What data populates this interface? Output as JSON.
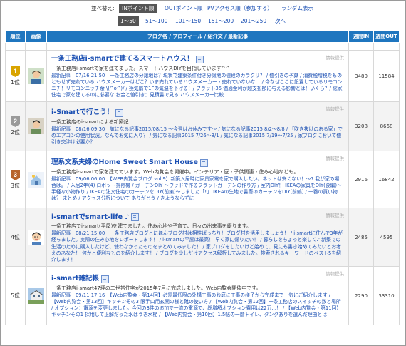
{
  "sort": {
    "label": "並べ替え:",
    "options": [
      "INポイント順",
      "OUTポイント順",
      "PVアクセス順（参加する）",
      "ランダム表示"
    ]
  },
  "pager": {
    "pages": [
      "1〜50",
      "51〜100",
      "101〜150",
      "151〜200",
      "201〜250",
      "次へ"
    ]
  },
  "table": {
    "headers": [
      "順位",
      "画像",
      "ブログ名 / プロフィール / 紹介文 / 最新記事",
      "週間IN",
      "週間OUT"
    ]
  },
  "rows": [
    {
      "rank": "1位",
      "medal_color": "#d9a400",
      "medal_num": "1",
      "title": "一条工務店i-smartで建てるスマートハウス！",
      "info": "情報提供",
      "desc": "一条工務店i-smartで家を建てました。スマートハウスDIYを目指しています^^",
      "posts": "最新記事　07/16 21:50　一条工務店の分譲地は？現状で建築条件付き分譲地の値段のカラクリ？ / 値引きの予算 / 消費税増税をものともせず売れている ハウスメーカーはどこ？いま売れているハウスメーカー・売れていないな… / 今なぜここに設置しているリモコンニチ！リモコンニッチ余 \\(^o^)/ / 換気扇で1Fの気温を下げる！/ フラット35 価適金利が超支払額に与える影響とは！いくら？/ 総家住宅で家を建てるのに必要な お金と値引き：見積書で見る ハウスメーカー比較",
      "in": "3480",
      "out": "11584"
    },
    {
      "rank": "2位",
      "medal_color": "#9a9a9a",
      "medal_num": "2",
      "title": "i-Smartで行こう！",
      "info": "情報提供",
      "desc": "一条工務店のi-smartによる新築記",
      "posts": "最新記事　08/16 09:30　気になる記事2015/08/15 〜今週はお休みです〜 / 気になる記事2015 8/2〜8/8 / 「吹き抜けのある家」でのエアコンの使用状況。なんでお気に入り？ / 気になる記事2015 7/26〜8/1 / 気になる記事2015 7/19〜7/25 / 家ブログにおいて値引き交渉は必要か？",
      "in": "3208",
      "out": "8668"
    },
    {
      "rank": "3位",
      "medal_color": "#b8642b",
      "medal_num": "3",
      "title": "理系文系夫婦のHome Sweet Smart House",
      "info": "情報提供",
      "desc": "一条工務店i-smartで家を建てています。Web内覧会を開催中。インテリア・庭・子供関連・住み心地なども。",
      "posts": "最新記事　09/06 06:00　【WEB内覧会ブログ vol.9】新築入居時に家具家電を家で購入したい。ネットは安くない！〜? 我が家の場合は。 / 入居2年(4) ロボット掃除機 / ガーデンDIY 〜ウッドで作るフラットガーデンの作り方 / 室内DIY！ IKEAの家具をDIY(後編)〜手軽な小物作り / IKEAの注文住宅のカーテンをDIY(前編)〜しました「!」 IKEAの生地で書斎のカーテンをDIY(前編) / 一番の買い物は？ まとめ / アクセス分析について ありがとう / きようならずに",
      "in": "2916",
      "out": "16842"
    },
    {
      "rank": "4位",
      "medal_color": "",
      "medal_num": "",
      "title": "i-smartでsmart-life ♪",
      "info": "情報提供",
      "desc": "一条工務店でi-smart(平屋)を建てました。住み心地や子育て、日々の出来事を綴ります。",
      "posts": "最新記事　08/21 15:00　一条工務店ブログとにほんブログ村は相性ばっちり！ブログ村を活用しましょう！ / i-smartに住んで3年が経ちました。実際の住み心地をレポートします！ / i-smartの平屋は最高！ 早く家に帰りたい！ / 暮らしをちょっと楽しく♪ 新築での生活のために購入したけど、使わなかったものをまとめてみました！ / 家ブログをしたいけど始めて、見にも書き始めてみたいとお考えのあなた！ 何かと便利なものを紹介します！ / ブログを少しだけアクセス解析してみました。検索されるキーワードのベスト5を紹介します！",
      "in": "2485",
      "out": "4595"
    },
    {
      "rank": "5位",
      "medal_color": "",
      "medal_num": "",
      "title": "i-smart雑記帳",
      "info": "情報提供",
      "desc": "一条工務店i-smart47坪の二世帯住宅が2015年7月に完成しました。Web内覧会開催中です。",
      "posts": "最新記事　09/11 17:16　【Web内覧会・第14回】必需最低限の外構工事のお庭に工事の様子から完成まで一気にご紹介します / 【Web内覧会・第13回】キッチンその3 限手口用玄関の様と靴の使い方 / 【Web内覧会・第12回】一条工務店のスイッチの数と場所 / オプション：電源を変更しました。今回の3件の追加で一流の電源で、総増額オプション費用は22万...！ / 【Web内覧会・第11回】キッチンその1 採用して正解だった水はうき水栓 / 【Web内覧会・第10回】1.5帖の一階トイレ、タンクありを選んだ理由とは",
      "in": "2290",
      "out": "33310"
    }
  ]
}
